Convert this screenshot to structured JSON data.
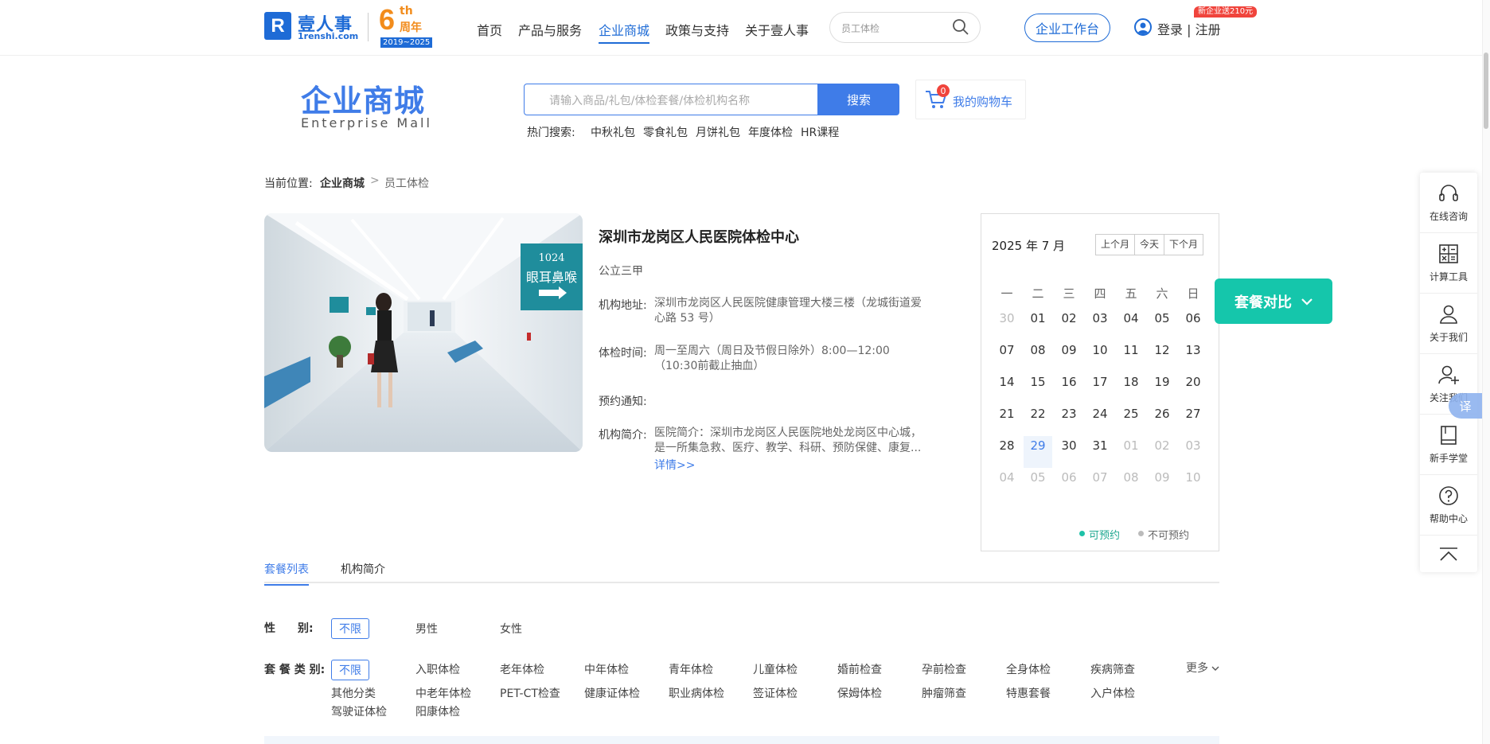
{
  "header": {
    "logo_mark": "R",
    "logo_text": "壹人事",
    "logo_sub": "1renshi.com",
    "anniv_num": "6",
    "anniv_th": "th",
    "anniv_zhou": "周年",
    "anniv_years": "2019~2025",
    "nav": [
      "首页",
      "产品与服务",
      "企业商城",
      "政策与支持",
      "关于壹人事"
    ],
    "nav_active_index": 2,
    "search_placeholder": "员工体检",
    "workbench": "企业工作台",
    "login": "登录 | 注册",
    "promo": "新企业送210元"
  },
  "mall": {
    "title": "企业商城",
    "subtitle": "Enterprise  Mall",
    "search_placeholder": "请输入商品/礼包/体检套餐/体检机构名称",
    "search_button": "搜索",
    "cart_count": "0",
    "cart_label": "我的购物车",
    "hot_label": "热门搜索:",
    "hot_terms": [
      "中秋礼包",
      "零食礼包",
      "月饼礼包",
      "年度体检",
      "HR课程"
    ]
  },
  "breadcrumb": {
    "label": "当前位置:",
    "mall": "企业商城",
    "sep": ">",
    "current": "员工体检"
  },
  "hospital": {
    "name": "深圳市龙岗区人民医院体检中心",
    "level": "公立三甲",
    "photo_sign_number": "1024",
    "photo_sign_text": "眼耳鼻喉",
    "address_label": "机构地址:",
    "address_line1": "深圳市龙岗区人民医院健康管理大楼三楼（龙城街道爱",
    "address_line2": "心路 53 号）",
    "hours_label": "体检时间:",
    "hours_line1": "周一至周六（周日及节假日除外）8:00—12:00",
    "hours_line2": "（10:30前截止抽血）",
    "notice_label": "预约通知:",
    "intro_label": "机构简介:",
    "intro_line1": "医院简介：深圳市龙岗区人民医院地处龙岗区中心城，",
    "intro_line2": "是一所集急救、医疗、教学、科研、预防保健、康复...",
    "detail_link": "详情>>"
  },
  "calendar": {
    "month": "2025 年 7 月",
    "buttons": [
      "上个月",
      "今天",
      "下个月"
    ],
    "weekdays": [
      "一",
      "二",
      "三",
      "四",
      "五",
      "六",
      "日"
    ],
    "weeks": [
      [
        "30",
        "01",
        "02",
        "03",
        "04",
        "05",
        "06"
      ],
      [
        "07",
        "08",
        "09",
        "10",
        "11",
        "12",
        "13"
      ],
      [
        "14",
        "15",
        "16",
        "17",
        "18",
        "19",
        "20"
      ],
      [
        "21",
        "22",
        "23",
        "24",
        "25",
        "26",
        "27"
      ],
      [
        "28",
        "29",
        "30",
        "31",
        "01",
        "02",
        "03"
      ],
      [
        "04",
        "05",
        "06",
        "07",
        "08",
        "09",
        "10"
      ]
    ],
    "legend_available": "可预约",
    "legend_unavailable": "不可预约"
  },
  "compare_button": "套餐对比",
  "tabs": [
    "套餐列表",
    "机构简介"
  ],
  "filters": {
    "gender_label": "性　　别:",
    "gender_options": [
      "不限",
      "男性",
      "女性"
    ],
    "category_label": "套 餐 类 别:",
    "category_row1": [
      "不限",
      "入职体检",
      "老年体检",
      "中年体检",
      "青年体检",
      "儿童体检",
      "婚前检查",
      "孕前检查",
      "全身体检",
      "疾病筛查"
    ],
    "category_row2": [
      "其他分类",
      "中老年体检",
      "PET-CT检查",
      "健康证体检",
      "职业病体检",
      "签证体检",
      "保姆体检",
      "肿瘤筛查",
      "特惠套餐",
      "入户体检"
    ],
    "category_row3": [
      "驾驶证体检",
      "阳康体检"
    ],
    "more": "更多"
  },
  "sidebar": {
    "items": [
      "在线咨询",
      "计算工具",
      "关于我们",
      "关注我们",
      "新手学堂",
      "帮助中心"
    ],
    "translate": "译"
  },
  "colors": {
    "brand_blue": "#1e6bd6",
    "mall_blue": "#3f7ce8",
    "compare_teal": "#15c6ab",
    "promo_red": "#f0443c",
    "anniv_orange": "#f28c1c"
  }
}
